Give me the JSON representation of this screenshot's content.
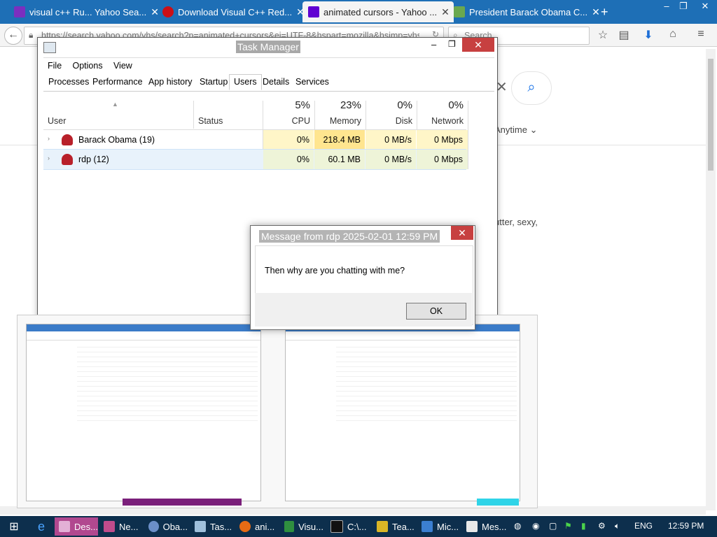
{
  "browser": {
    "tabs": [
      {
        "label": "visual c++ Ru... Yahoo Sea...",
        "icon": "yahoo-icon",
        "color": "#7b2fbf"
      },
      {
        "label": "Download Visual C++ Red...",
        "icon": "opera-icon",
        "color": "#cc0f16"
      },
      {
        "label": "animated cursors - Yahoo ...",
        "icon": "yahoo-icon",
        "color": "#6001d2"
      },
      {
        "label": "President Barack Obama C...",
        "icon": "page-icon",
        "color": "#6aa84f"
      }
    ],
    "url": "https://search.yahoo.com/yhs/search?p=animated+cursors&ei=UTF-8&hspart=mozilla&hsimp=yhs",
    "search_placeholder": "Search",
    "page_fragments": {
      "anytime": "Anytime",
      "snippet": "utter, sexy,"
    }
  },
  "task_manager": {
    "title": "Task Manager",
    "menu": [
      "File",
      "Options",
      "View"
    ],
    "tabs": [
      "Processes",
      "Performance",
      "App history",
      "Startup",
      "Users",
      "Details",
      "Services"
    ],
    "selected_tab": "Users",
    "columns": {
      "user": "User",
      "status": "Status",
      "cpu_pct": "5%",
      "cpu": "CPU",
      "mem_pct": "23%",
      "memory": "Memory",
      "disk_pct": "0%",
      "disk": "Disk",
      "net_pct": "0%",
      "network": "Network"
    },
    "rows": [
      {
        "name": "Barack Obama (19)",
        "status": "",
        "cpu": "0%",
        "memory": "218.4 MB",
        "disk": "0 MB/s",
        "network": "0 Mbps"
      },
      {
        "name": "rdp (12)",
        "status": "",
        "cpu": "0%",
        "memory": "60.1 MB",
        "disk": "0 MB/s",
        "network": "0 Mbps"
      }
    ]
  },
  "message_box": {
    "title": "Message from rdp 2025-02-01 12:59 PM",
    "text": "Then why are you chatting with me?",
    "ok_label": "OK"
  },
  "taskbar": {
    "items": [
      {
        "label": "Des...",
        "icon": "remote-desktop-icon"
      },
      {
        "label": "Ne...",
        "icon": "remote-desktop-icon"
      },
      {
        "label": "Oba...",
        "icon": "obama-icon"
      },
      {
        "label": "Tas...",
        "icon": "task-manager-icon"
      },
      {
        "label": "ani...",
        "icon": "firefox-icon"
      },
      {
        "label": "Visu...",
        "icon": "visual-studio-icon"
      },
      {
        "label": "C:\\...",
        "icon": "cmd-icon"
      },
      {
        "label": "Tea...",
        "icon": "teamviewer-icon"
      },
      {
        "label": "Mic...",
        "icon": "microsoft-icon"
      },
      {
        "label": "Mes...",
        "icon": "message-icon"
      }
    ],
    "lang": "ENG",
    "time": "12:59 PM"
  },
  "colors": {
    "accent": "#1e6fb6",
    "tm_highlight": "#fff6c8",
    "tm_mem_highlight": "#ffe58f",
    "taskbar": "#0d2f4d"
  }
}
